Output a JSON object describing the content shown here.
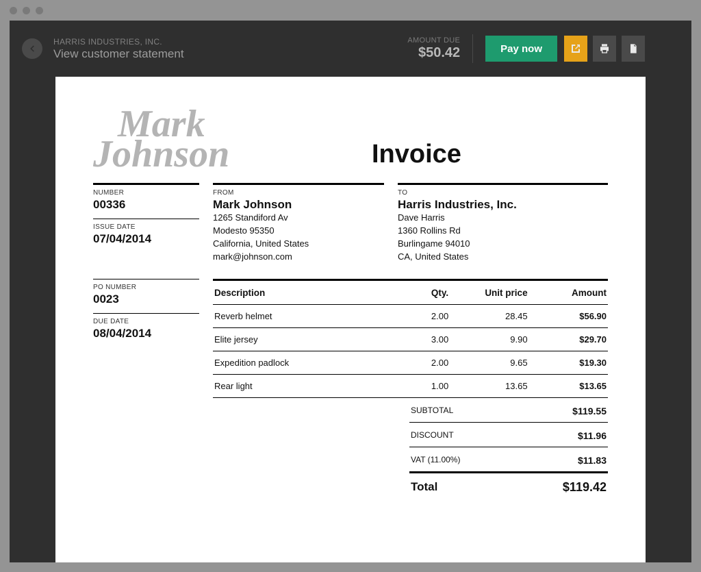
{
  "header": {
    "company": "HARRIS INDUSTRIES, INC.",
    "view_statement": "View customer statement",
    "amount_due_label": "AMOUNT DUE",
    "amount_due_value": "$50.42",
    "pay_now": "Pay now"
  },
  "invoice": {
    "signature_first": "Mark",
    "signature_last": "Johnson",
    "title": "Invoice",
    "number_label": "NUMBER",
    "number": "00336",
    "issue_date_label": "ISSUE DATE",
    "issue_date": "07/04/2014",
    "po_number_label": "PO NUMBER",
    "po_number": "0023",
    "due_date_label": "DUE DATE",
    "due_date": "08/04/2014",
    "from_label": "FROM",
    "from": {
      "name": "Mark Johnson",
      "line1": "1265 Standiford Av",
      "line2": "Modesto 95350",
      "line3": "California, United States",
      "line4": "mark@johnson.com"
    },
    "to_label": "TO",
    "to": {
      "name": "Harris Industries, Inc.",
      "line1": "Dave Harris",
      "line2": "1360 Rollins Rd",
      "line3": "Burlingame 94010",
      "line4": "CA, United States"
    },
    "columns": {
      "description": "Description",
      "qty": "Qty.",
      "unit_price": "Unit price",
      "amount": "Amount"
    },
    "items": [
      {
        "desc": "Reverb helmet",
        "qty": "2.00",
        "price": "28.45",
        "amount": "$56.90"
      },
      {
        "desc": "Elite jersey",
        "qty": "3.00",
        "price": "9.90",
        "amount": "$29.70"
      },
      {
        "desc": "Expedition padlock",
        "qty": "2.00",
        "price": "9.65",
        "amount": "$19.30"
      },
      {
        "desc": "Rear light",
        "qty": "1.00",
        "price": "13.65",
        "amount": "$13.65"
      }
    ],
    "totals": {
      "subtotal_label": "SUBTOTAL",
      "subtotal": "$119.55",
      "discount_label": "DISCOUNT",
      "discount": "$11.96",
      "vat_label": "VAT (11.00%)",
      "vat": "$11.83",
      "total_label": "Total",
      "total": "$119.42"
    }
  }
}
